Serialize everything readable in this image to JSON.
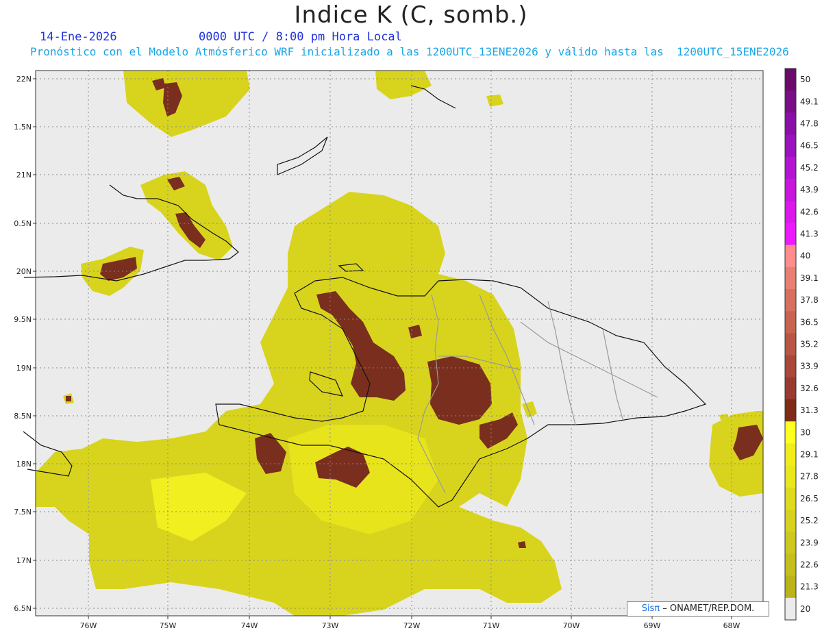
{
  "header": {
    "title": "Indice K (C, somb.)",
    "date": "14-Ene-2026",
    "time": "0000 UTC / 8:00 pm Hora Local",
    "forecast": "Pronóstico con el Modelo Atmósferico WRF inicializado a las 1200UTC_13ENE2026 y válido hasta las  1200UTC_15ENE2026"
  },
  "axes": {
    "lat_labels": [
      "22N",
      "1.5N",
      "21N",
      "0.5N",
      "20N",
      "9.5N",
      "19N",
      "8.5N",
      "18N",
      "7.5N",
      "17N",
      "6.5N"
    ],
    "lon_labels": [
      "76W",
      "75W",
      "74W",
      "73W",
      "72W",
      "71W",
      "70W",
      "69W",
      "68W"
    ]
  },
  "colorbar": {
    "labels": [
      "50",
      "49.1",
      "47.8",
      "46.5",
      "45.2",
      "43.9",
      "42.6",
      "41.3",
      "40",
      "39.1",
      "37.8",
      "36.5",
      "35.2",
      "33.9",
      "32.6",
      "31.3",
      "30",
      "29.1",
      "27.8",
      "26.5",
      "25.2",
      "23.9",
      "22.6",
      "21.3",
      "20"
    ],
    "colors": [
      "#6a0a6a",
      "#7a0e86",
      "#8a0fa6",
      "#9a11be",
      "#b214cf",
      "#c816dc",
      "#dc18ea",
      "#ee1aff",
      "#ff8c8c",
      "#e87f73",
      "#d8705f",
      "#c8634f",
      "#b85544",
      "#a8473a",
      "#983a30",
      "#7e2c16",
      "#ffff20",
      "#f2ed1a",
      "#e8e81c",
      "#deda1e",
      "#d6d21e",
      "#ccc81e",
      "#c4bf1c",
      "#bab41a",
      "#ebebeb"
    ]
  },
  "colors": {
    "ocean": "#ebebeb",
    "high_k": "#7a2e1e",
    "mid_k": "#d6d61c",
    "low_k": "#c4bf1c",
    "bright_k": "#f2f020"
  },
  "credit": {
    "brand": "Sisπ",
    "org": " – ONAMET/REP.DOM."
  }
}
